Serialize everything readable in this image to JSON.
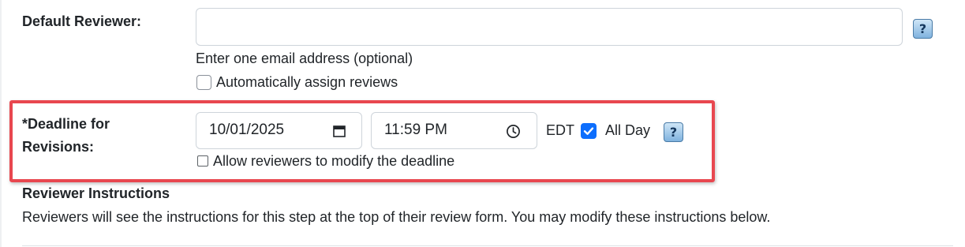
{
  "default_reviewer": {
    "label": "Default Reviewer:",
    "email_value": "",
    "hint": "Enter one email address (optional)",
    "auto_assign_label": "Automatically assign reviews",
    "auto_assign_checked": false,
    "help_icon": "?"
  },
  "deadline": {
    "label_line1": "*Deadline for",
    "label_line2": "Revisions:",
    "date_value": "10/01/2025",
    "time_value": "11:59 PM",
    "timezone": "EDT",
    "all_day_label": "All Day",
    "all_day_checked": true,
    "allow_modify_label": "Allow reviewers to modify the deadline",
    "allow_modify_checked": false,
    "help_icon": "?",
    "icons": [
      "calendar-icon",
      "clock-icon"
    ]
  },
  "instructions": {
    "heading": "Reviewer Instructions",
    "text": "Reviewers will see the instructions for this step at the top of their review form. You may modify these instructions below."
  },
  "colors": {
    "highlight_border": "#e8474f",
    "checkbox_checked": "#0d6efd"
  }
}
